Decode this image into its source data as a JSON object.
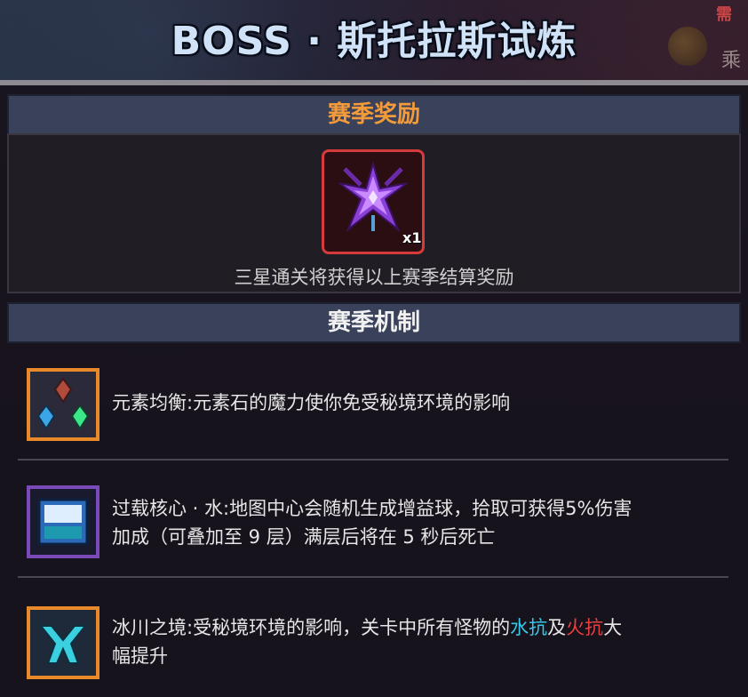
{
  "header": {
    "title": "BOSS · 斯托拉斯试炼",
    "top_right_label": "需",
    "top_right_label2": "乘"
  },
  "rewards": {
    "section_title": "赛季奖励",
    "item_icon": "purple-star-shard-icon",
    "item_quantity": "x1",
    "description": "三星通关将获得以上赛季结算奖励",
    "slot_border_color": "#d63b3b"
  },
  "mechanics": {
    "section_title": "赛季机制",
    "items": [
      {
        "icon": "elemental-stones-icon",
        "icon_border_color": "#e88a2a",
        "text": "元素均衡:元素石的魔力使你免受秘境环境的影响"
      },
      {
        "icon": "overload-core-water-icon",
        "icon_border_color": "#7a4ab8",
        "line1": "过载核心 · 水:地图中心会随机生成增益球，拾取可获得5%伤害",
        "line2": "加成（可叠加至 9 层）满层后将在 5 秒后死亡"
      },
      {
        "icon": "glacier-realm-icon",
        "icon_border_color": "#e88a2a",
        "text_before": "冰川之境:受秘境环境的影响，关卡中所有怪物的",
        "water_resist": "水抗",
        "text_and": "及",
        "fire_resist": "火抗",
        "text_after": "大",
        "line2": "幅提升"
      }
    ]
  },
  "colors": {
    "water": "#38c7e8",
    "fire": "#e84040",
    "rewards_title": "#f39a3a"
  }
}
